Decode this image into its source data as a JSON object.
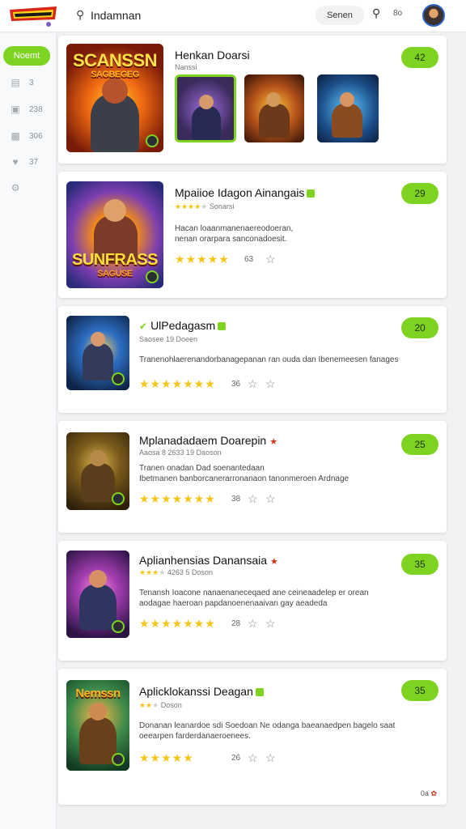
{
  "header": {
    "search_value": "Indamnan",
    "pill_label": "Senen",
    "count": "8o"
  },
  "sidebar": {
    "home_label": "Noemt",
    "items": [
      {
        "icon": "list-icon",
        "count": "3"
      },
      {
        "icon": "chat-icon",
        "count": "238"
      },
      {
        "icon": "image-icon",
        "count": "306"
      },
      {
        "icon": "heart-icon",
        "count": "37"
      },
      {
        "icon": "settings-icon",
        "count": ""
      }
    ]
  },
  "cards": [
    {
      "title": "Henkan Doarsi",
      "meta": "Nanssi",
      "score": "42",
      "art_title": "SCANSSN",
      "art_sub": "SAGBEGEG"
    },
    {
      "title": "Mpaiioe Idagon Ainangais",
      "meta": "Sonarsi",
      "desc_lines": [
        "Hacan loaanmanenaereodoeran,",
        "nenan orarpara sanconadoesit."
      ],
      "stars": "★★★★★",
      "rating": "63",
      "score": "29",
      "art_title": "SUNFRASS",
      "art_sub": "SAGUSE"
    },
    {
      "title": "UlPedagasm",
      "meta": "Saosee 19 Doeen",
      "desc_lines": [
        "Tranenohlaerenandorbanagepanan ran ouda dan Ibenemeesen fanages"
      ],
      "stars": "★★★★★★★",
      "rating": "36",
      "score": "20"
    },
    {
      "title": "Mplanadadaem Doarepin",
      "meta": "Aaosa 8 2633 19 Daoson",
      "desc_lines": [
        "Tranen onadan Dad soenantedaan",
        "Ibetmanen banborcanerarronanaon tanonmeroen Ardnage"
      ],
      "stars": "★★★★★★★",
      "rating": "38",
      "score": "25"
    },
    {
      "title": "Aplianhensias Danansaia",
      "meta": "4263 5 Doson",
      "desc_lines": [
        "Tenansh Ioacone nanaenaneceqaed ane ceineaadelep er orean",
        "aodagae haeroan papdanoenenaaivan gay aeadeda"
      ],
      "stars": "★★★★★★★",
      "rating": "28",
      "score": "35"
    },
    {
      "title": "Aplicklokanssi Deagan",
      "meta": "Doson",
      "desc_lines": [
        "Donanan leanardoe sdi Soedoan Ne odanga baeanaedpen bagelo saat",
        "oeearpen farderdanaeroenees."
      ],
      "stars": "★★★★★",
      "rating": "26",
      "score": "35",
      "art_title": "Nemssn"
    }
  ],
  "footer": {
    "count": "0a"
  }
}
